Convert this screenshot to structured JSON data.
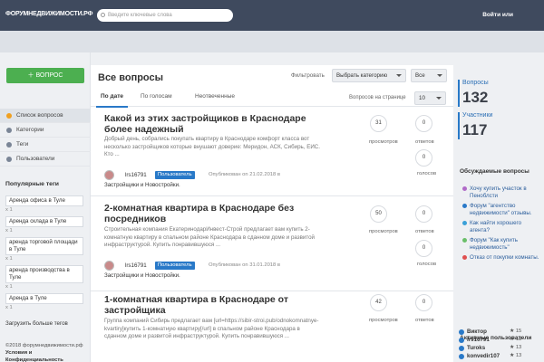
{
  "header": {
    "logo": "ФОРУМНЕДВИЖИМОСТИ.РФ",
    "search_placeholder": "Введите ключевые слова",
    "login": "Войти или"
  },
  "sidebar": {
    "ask_button": "ВОПРОС",
    "nav": [
      {
        "label": "Список вопросов",
        "icon": "list-icon"
      },
      {
        "label": "Категории",
        "icon": "folder-icon"
      },
      {
        "label": "Теги",
        "icon": "tag-icon"
      },
      {
        "label": "Пользователи",
        "icon": "users-icon"
      }
    ],
    "popular_title": "Популярные теги",
    "tags": [
      {
        "label": "Аренда офиса в Туле",
        "count": "x 1"
      },
      {
        "label": "Аренда склада в Туле",
        "count": "x 1"
      },
      {
        "label": "аренда торговой площади в Туле",
        "count": "x 1"
      },
      {
        "label": "аренда производства в Туле",
        "count": "x 1"
      },
      {
        "label": "Аренда в Туле",
        "count": "x 1"
      }
    ],
    "more_tags": "Загрузить больше тегов",
    "copyright": "©2018 форумнедвижимости.рф",
    "terms": "Условия и Конфиденциальность"
  },
  "main": {
    "title": "Все вопросы",
    "filter_label": "Фильтровать",
    "filter_select": "Выбрать категорию",
    "filter_all": "Все",
    "tabs": [
      "По дате",
      "По голосам",
      "Неотвеченные"
    ],
    "per_page_label": "Вопросов на странице",
    "per_page": "10",
    "questions": [
      {
        "title": "Какой из этих застройщиков в Краснодаре более надежный",
        "excerpt": "Добрый день, собрались покупать квартиру в Краснодаре комфорт класса вот несколько застройщиков которые внушают доверие: Меридон, АСК, Сибирь, ЕИС. Кто ...",
        "user": "lrs16791",
        "role": "Пользователь",
        "published": "Опубликован on 21.02.2018 в",
        "category": "Застройщики и Новостройки.",
        "views": "31",
        "answers": "0",
        "votes": "0"
      },
      {
        "title": "2-комнатная квартира в Краснодаре без посредников",
        "excerpt": "Строительная компания ЕкатеринодарИнвест-Строй предлагает вам купить 2-комнатную квартиру в спальном районе Краснодара в сданном доме и развитой инфраструктурой. Купить понравившуюся ...",
        "user": "lrs16791",
        "role": "Пользователь",
        "published": "Опубликован on 31.01.2018 в",
        "category": "Застройщики и Новостройки.",
        "views": "50",
        "answers": "0",
        "votes": "0"
      },
      {
        "title": "1-комнатная квартира в Краснодаре от застройщика",
        "excerpt": "Группа компаний Сибирь предлагает вам [url=https://sibir-stroi.pub/odnokomnatnye-kvartiry]купить 1-комнатную квартиру[/url] в спальном районе Краснодара в сданном доме и развитой инфраструктурой. Купить понравившуюся ...",
        "user": "",
        "role": "",
        "published": "",
        "category": "",
        "views": "42",
        "answers": "0",
        "votes": ""
      }
    ],
    "lbl_views": "просмотров",
    "lbl_answers": "ответов",
    "lbl_votes": "голосов"
  },
  "right": {
    "questions_label": "Вопросы",
    "questions_count": "132",
    "members_label": "Участники",
    "members_count": "117",
    "discussed_title": "Обсуждаемые вопросы",
    "discussed": [
      {
        "label": "Хочу купить участок в Пеноблсти",
        "color": "#b06ac8"
      },
      {
        "label": "Форум \"агентство недвижимости\" отзывы.",
        "color": "#2979c8"
      },
      {
        "label": "Как найти хорошего агента?",
        "color": "#3aa0d8"
      },
      {
        "label": "Форум \"Как купить недвижимость\"",
        "color": "#6abf69"
      },
      {
        "label": "Отказ от покупки комнаты.",
        "color": "#e05050"
      }
    ],
    "active_title": "Активные пользователи",
    "users": [
      {
        "name": "Виктор",
        "score": "15"
      },
      {
        "name": "lrs16791",
        "score": "13"
      },
      {
        "name": "Turoks",
        "score": "13"
      },
      {
        "name": "konvedir107",
        "score": "13"
      }
    ]
  }
}
